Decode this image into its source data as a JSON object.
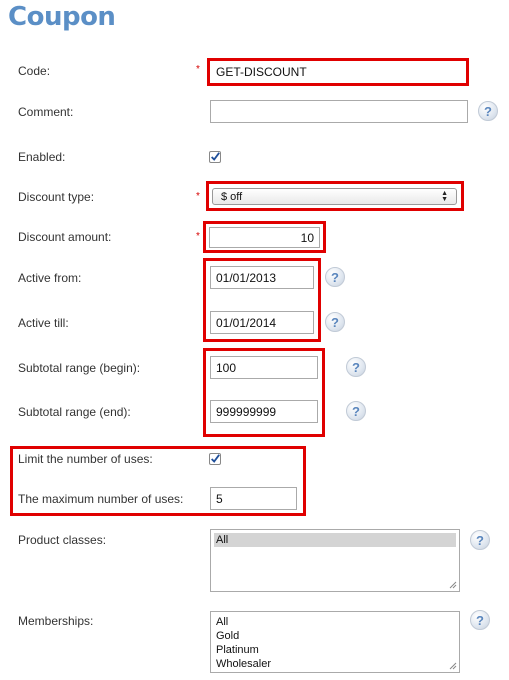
{
  "page": {
    "title": "Coupon"
  },
  "fields": {
    "code": {
      "label": "Code:",
      "value": "GET-DISCOUNT",
      "required": "*"
    },
    "comment": {
      "label": "Comment:",
      "value": "",
      "help": "?"
    },
    "enabled": {
      "label": "Enabled:",
      "checked": true
    },
    "discount_type": {
      "label": "Discount type:",
      "value": "$ off",
      "required": "*"
    },
    "discount_amount": {
      "label": "Discount amount:",
      "value": "10",
      "required": "*"
    },
    "active_from": {
      "label": "Active from:",
      "value": "01/01/2013",
      "help": "?"
    },
    "active_till": {
      "label": "Active till:",
      "value": "01/01/2014",
      "help": "?"
    },
    "subtotal_begin": {
      "label": "Subtotal range (begin):",
      "value": "100",
      "help": "?"
    },
    "subtotal_end": {
      "label": "Subtotal range (end):",
      "value": "999999999",
      "help": "?"
    },
    "limit_uses": {
      "label": "Limit the number of uses:",
      "checked": true
    },
    "max_uses": {
      "label": "The maximum number of uses:",
      "value": "5"
    },
    "product_classes": {
      "label": "Product classes:",
      "options": [
        "All"
      ],
      "selected": "All",
      "help": "?"
    },
    "memberships": {
      "label": "Memberships:",
      "options": [
        "All",
        "Gold",
        "Platinum",
        "Wholesaler"
      ],
      "help": "?"
    }
  },
  "colors": {
    "title": "#5b8fc6",
    "highlight": "#e00000",
    "required": "#d60000",
    "checkmark": "#1f4f9a"
  }
}
